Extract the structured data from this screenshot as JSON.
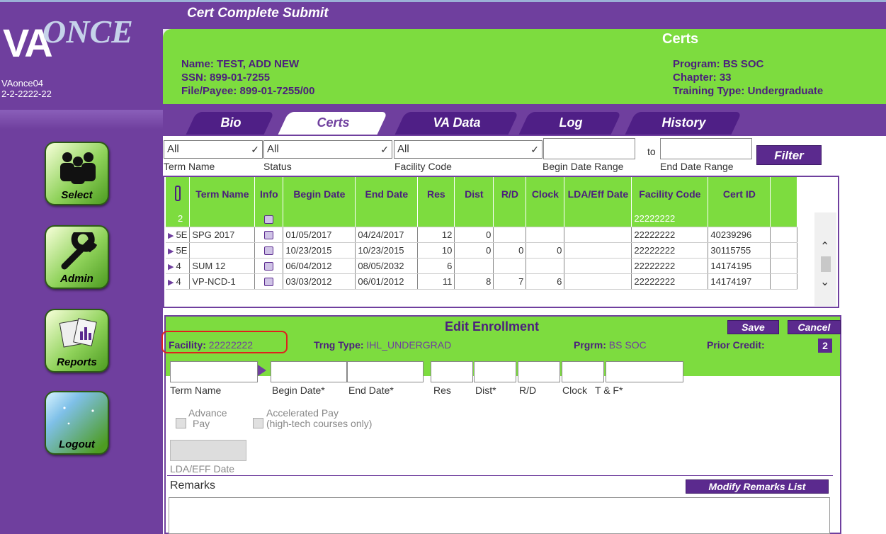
{
  "app": {
    "title": "Cert Complete Submit",
    "logo_va": "VA",
    "logo_once": "ONCE",
    "session_id": "VAonce04",
    "session_code": "2-2-2222-22"
  },
  "header": {
    "section_title": "Certs",
    "name": "Name: TEST, ADD NEW",
    "ssn": "SSN: 899-01-7255",
    "file_payee": "File/Payee: 899-01-7255/00",
    "program": "Program: BS SOC",
    "chapter": "Chapter: 33",
    "training_type": "Training Type: Undergraduate"
  },
  "tabs": [
    {
      "label": "Bio"
    },
    {
      "label": "Certs"
    },
    {
      "label": "VA Data"
    },
    {
      "label": "Log"
    },
    {
      "label": "History"
    }
  ],
  "nav": [
    {
      "label": "Select"
    },
    {
      "label": "Admin"
    },
    {
      "label": "Reports"
    },
    {
      "label": "Logout"
    }
  ],
  "filters": {
    "term_name_value": "All",
    "term_name_label": "Term Name",
    "status_value": "All",
    "status_label": "Status",
    "facility_value": "All",
    "facility_label": "Facility Code",
    "begin_label": "Begin Date Range",
    "to_label": "to",
    "end_label": "End Date Range",
    "filter_button": "Filter"
  },
  "grid": {
    "columns": [
      "",
      "Term Name",
      "Info",
      "Begin Date",
      "End Date",
      "Res",
      "Dist",
      "R/D",
      "Clock",
      "LDA/Eff Date",
      "Facility Code",
      "Cert ID"
    ],
    "rows": [
      {
        "ch": "2",
        "term": "",
        "begin": "",
        "end": "",
        "res": "",
        "dist": "",
        "rd": "",
        "clock": "",
        "lda": "",
        "facility": "22222222",
        "cert": "",
        "selected": true
      },
      {
        "ch": "5E",
        "term": "SPG 2017",
        "begin": "01/05/2017",
        "end": "04/24/2017",
        "res": "12",
        "dist": "0",
        "rd": "",
        "clock": "",
        "lda": "",
        "facility": "22222222",
        "cert": "40239296"
      },
      {
        "ch": "5E",
        "term": "",
        "begin": "10/23/2015",
        "end": "10/23/2015",
        "res": "10",
        "dist": "0",
        "rd": "0",
        "clock": "0",
        "lda": "",
        "facility": "22222222",
        "cert": "30115755"
      },
      {
        "ch": "4",
        "term": "SUM 12",
        "begin": "06/04/2012",
        "end": "08/05/2032",
        "res": "6",
        "dist": "",
        "rd": "",
        "clock": "",
        "lda": "",
        "facility": "22222222",
        "cert": "14174195"
      },
      {
        "ch": "4",
        "term": "VP-NCD-1",
        "begin": "03/03/2012",
        "end": "06/01/2012",
        "res": "11",
        "dist": "8",
        "rd": "7",
        "clock": "6",
        "lda": "",
        "facility": "22222222",
        "cert": "14174197"
      }
    ]
  },
  "edit": {
    "title": "Edit Enrollment",
    "save": "Save",
    "cancel": "Cancel",
    "facility_label": "Facility:",
    "facility_value": "22222222",
    "trng_label": "Trng Type:",
    "trng_value": "IHL_UNDERGRAD",
    "prgrm_label": "Prgrm:",
    "prgrm_value": "BS SOC",
    "prior_label": "Prior Credit:",
    "prior_value": "2",
    "fields": {
      "term": "Term Name",
      "begin": "Begin Date*",
      "end": "End Date*",
      "res": "Res",
      "dist": "Dist*",
      "rd": "R/D",
      "clock": "Clock",
      "tf": "T & F*"
    },
    "advance_pay_1": "Advance",
    "advance_pay_2": "Pay",
    "accel_pay_1": "Accelerated Pay",
    "accel_pay_2": "(high-tech courses only)",
    "lda_label": "LDA/EFF Date",
    "remarks_label": "Remarks",
    "modify_remarks": "Modify Remarks List"
  },
  "colors": {
    "purple": "#6f3f9e",
    "green": "#7ddc3f",
    "dark_purple": "#4b1f7d",
    "highlight": "#e0201e"
  }
}
